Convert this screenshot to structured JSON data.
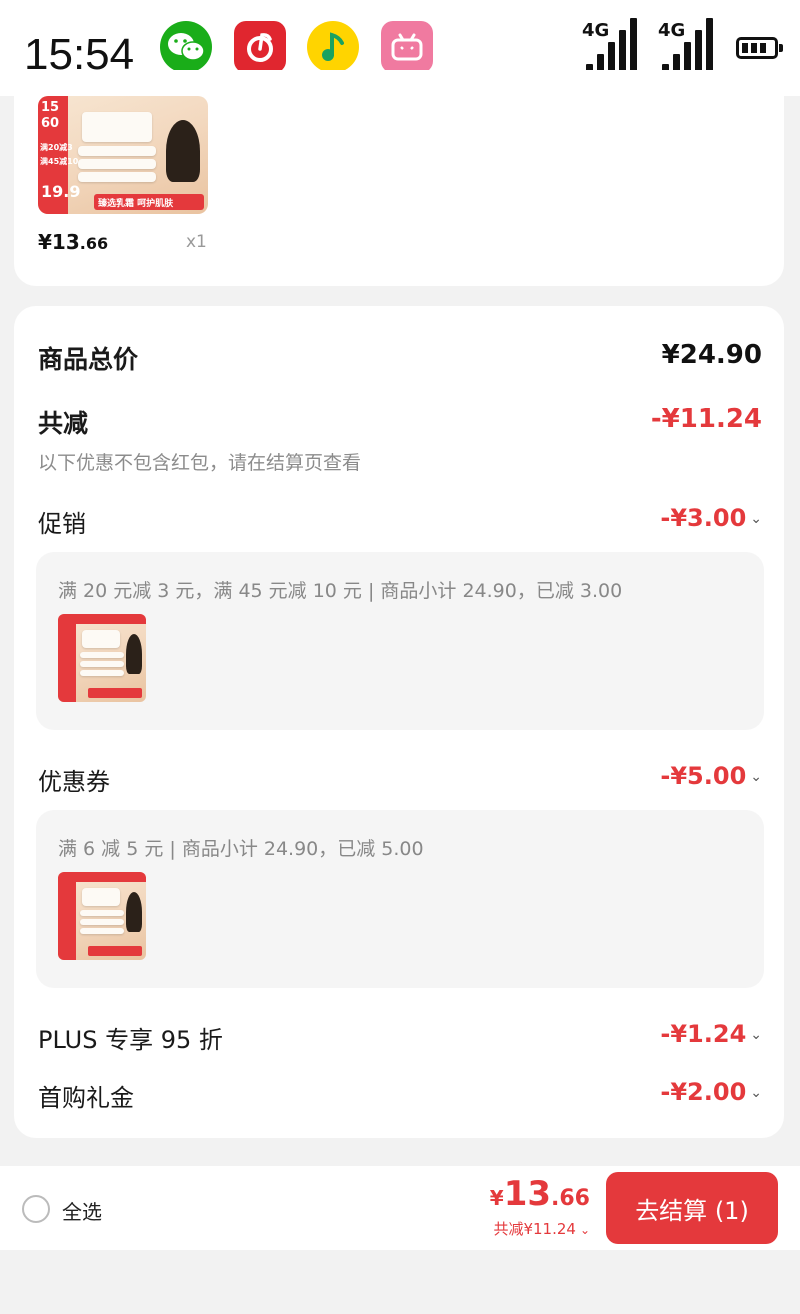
{
  "status_bar": {
    "time": "15:54",
    "apps": [
      "wechat-icon",
      "netease-music-icon",
      "qq-music-icon",
      "bilibili-icon"
    ],
    "signal_labels": [
      "4G",
      "4G"
    ]
  },
  "product": {
    "image": {
      "badge_top": "15",
      "badge_mid": "60",
      "tag1": "满20减3",
      "tag2": "满45减10",
      "promo_price": "19.9",
      "slogan": "臻选乳霜 呵护肌肤"
    },
    "price": "¥13.66",
    "price_int": "¥13",
    "price_dec": ".66",
    "quantity": "x1"
  },
  "summary": {
    "total_label": "商品总价",
    "total_value": "¥24.90",
    "discount_label": "共减",
    "discount_value": "-¥11.24",
    "discount_note": "以下优惠不包含红包，请在结算页查看"
  },
  "promotions": {
    "label": "促销",
    "value": "-¥3.00",
    "detail": "满 20 元减 3 元，满 45 元减 10 元 | 商品小计 24.90，已减 3.00"
  },
  "coupons": {
    "label": "优惠券",
    "value": "-¥5.00",
    "detail": "满 6 减 5 元 | 商品小计 24.90，已减 5.00"
  },
  "plus": {
    "label": "PLUS 专享 95 折",
    "value": "-¥1.24"
  },
  "first_purchase": {
    "label": "首购礼金",
    "value": "-¥2.00"
  },
  "bottom_bar": {
    "select_all": "全选",
    "currency": "¥",
    "total_int": "13",
    "total_dec": ".66",
    "discount": "共减¥11.24",
    "checkout": "去结算 (1)"
  },
  "colors": {
    "accent": "#e4393c",
    "wechat": "#1aad19",
    "netease": "#e0262f",
    "qqmusic": "#ffd400",
    "bilibili": "#f07aa0"
  }
}
